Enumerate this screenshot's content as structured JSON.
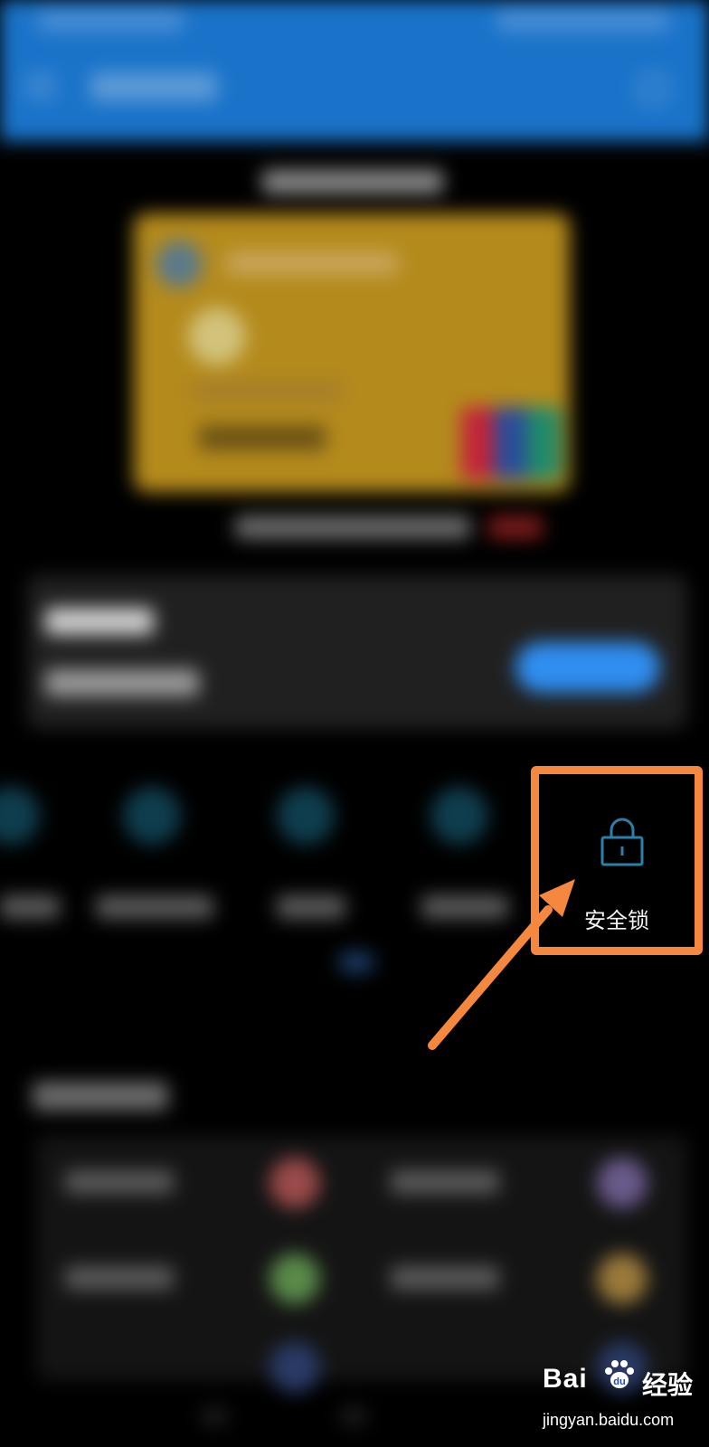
{
  "highlight": {
    "label": "安全锁",
    "icon": "lock-icon",
    "accent_color": "#f5883e",
    "icon_color": "#2b7fa8"
  },
  "theme": {
    "appbar_color": "#1a73c9",
    "background": "#000000"
  },
  "watermark": {
    "brand_prefix": "Bai",
    "brand_suffix": "du",
    "brand_cn": "经验",
    "url": "jingyan.baidu.com"
  }
}
